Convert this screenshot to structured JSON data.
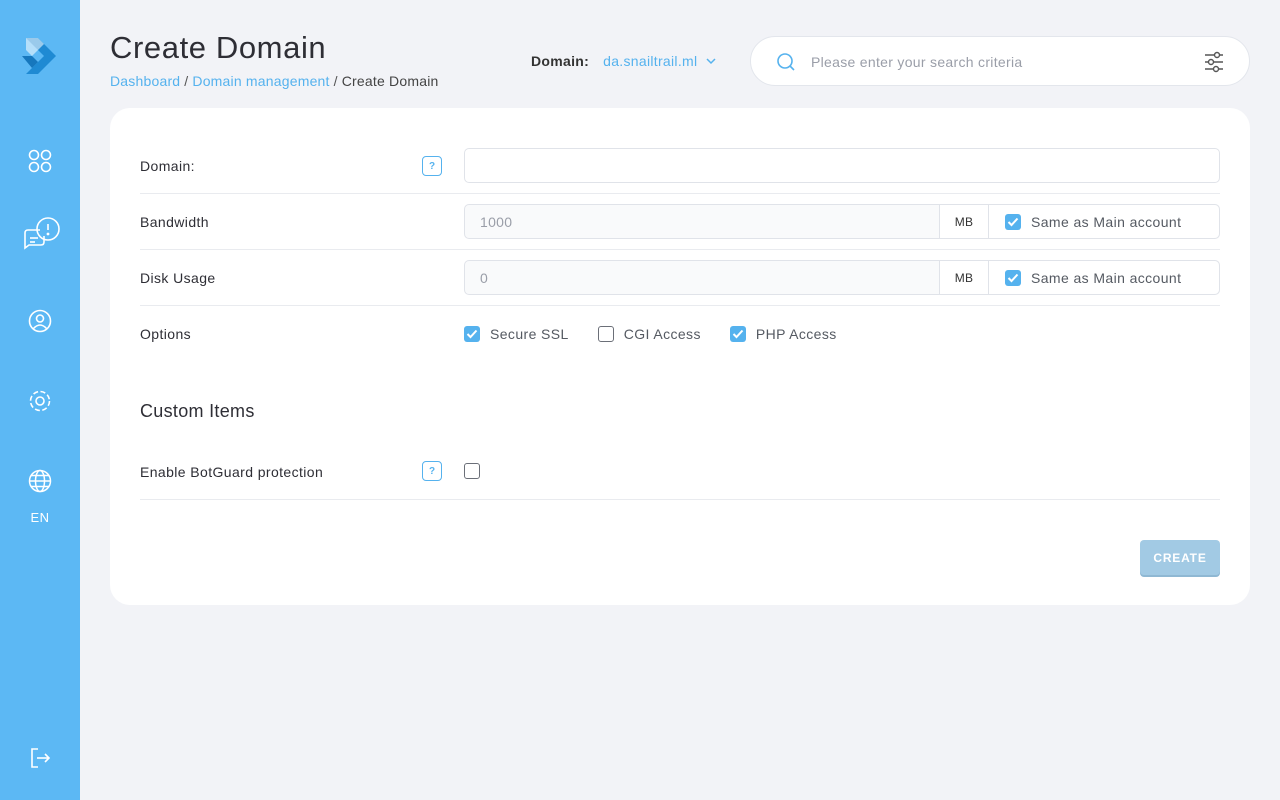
{
  "sidebar": {
    "logo_icon": "chevron-logo-icon",
    "items": [
      {
        "name": "dashboard",
        "icon": "four-circles-icon"
      },
      {
        "name": "messages",
        "icon": "chat-alert-icon"
      },
      {
        "name": "account",
        "icon": "user-circle-icon"
      },
      {
        "name": "settings",
        "icon": "gear-icon"
      },
      {
        "name": "language",
        "icon": "globe-icon"
      }
    ],
    "language_label": "EN",
    "logout_icon": "logout-icon"
  },
  "header": {
    "title": "Create Domain",
    "breadcrumb": [
      {
        "label": "Dashboard"
      },
      {
        "label": "Domain management"
      },
      {
        "label": "Create Domain"
      }
    ],
    "domain_label": "Domain:",
    "domain_value": "da.snailtrail.ml",
    "search_placeholder": "Please enter your search criteria"
  },
  "form": {
    "domain": {
      "label": "Domain:",
      "value": ""
    },
    "bandwidth": {
      "label": "Bandwidth",
      "placeholder": "1000",
      "unit": "MB",
      "same_label": "Same as Main account",
      "same_checked": true
    },
    "disk_usage": {
      "label": "Disk Usage",
      "placeholder": "0",
      "unit": "MB",
      "same_label": "Same as Main account",
      "same_checked": true
    },
    "options": {
      "label": "Options",
      "items": [
        {
          "label": "Secure SSL",
          "checked": true
        },
        {
          "label": "CGI Access",
          "checked": false
        },
        {
          "label": "PHP Access",
          "checked": true
        }
      ]
    },
    "custom_items_title": "Custom Items",
    "botguard": {
      "label": "Enable BotGuard protection",
      "checked": false
    },
    "help_glyph": "?",
    "create_label": "CREATE"
  },
  "colors": {
    "sidebar": "#5cb8f4",
    "accent": "#55b2ee",
    "create_button": "#a2cae4"
  }
}
